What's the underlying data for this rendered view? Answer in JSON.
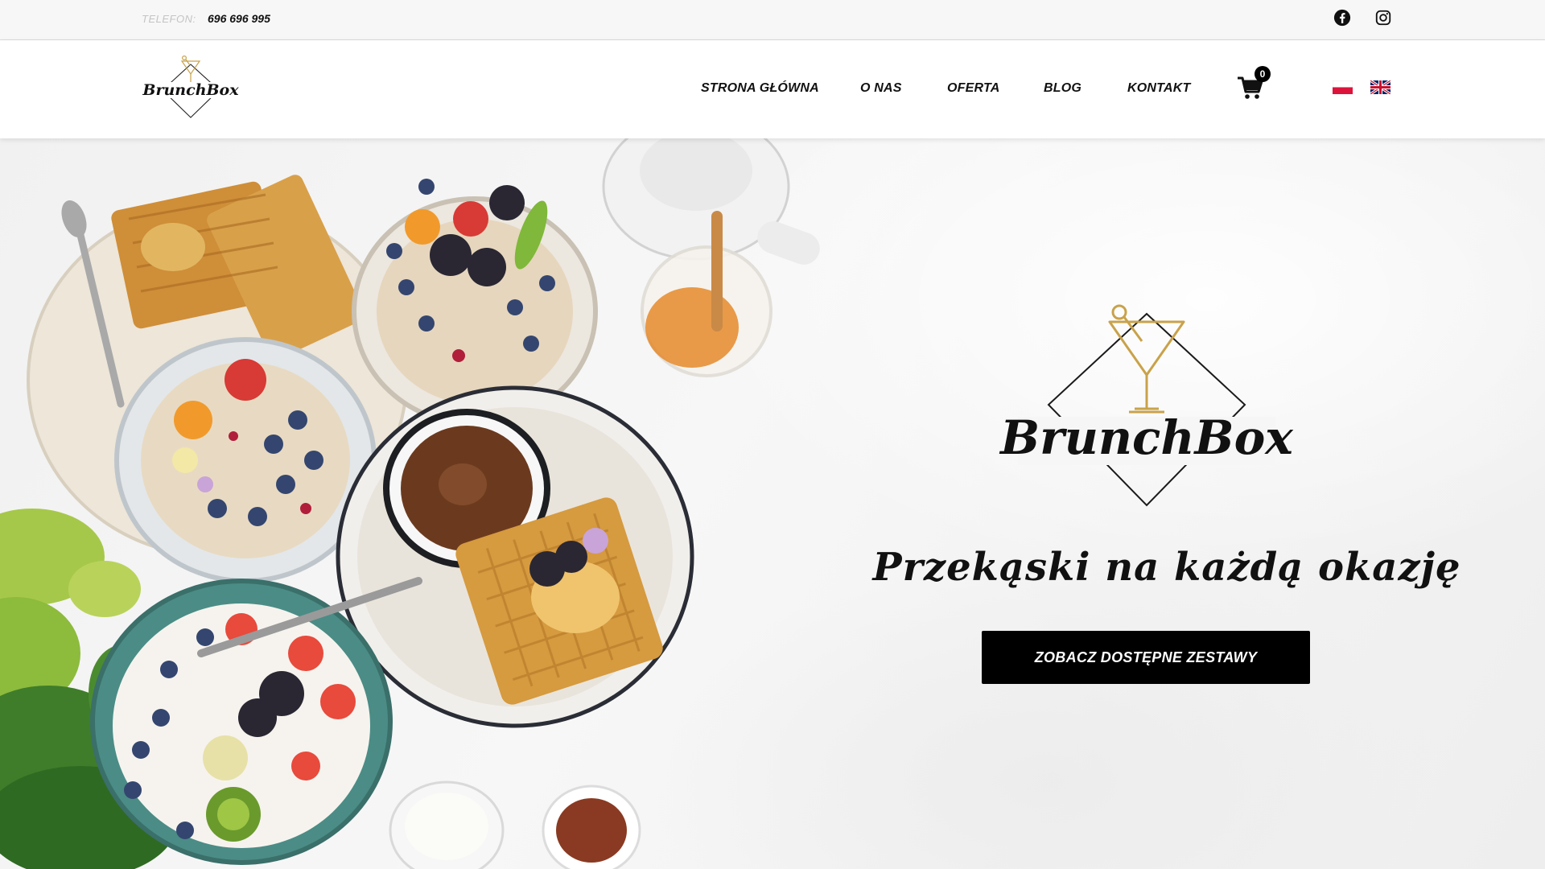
{
  "topbar": {
    "phone_label": "TELEFON:",
    "phone_number": "696 696 995",
    "social": [
      {
        "name": "facebook-icon"
      },
      {
        "name": "instagram-icon"
      }
    ]
  },
  "header": {
    "logo_text": "BrunchBox",
    "nav": [
      {
        "label": "STRONA GŁÓWNA"
      },
      {
        "label": "O NAS"
      },
      {
        "label": "OFERTA"
      },
      {
        "label": "BLOG"
      },
      {
        "label": "KONTAKT"
      }
    ],
    "cart_count": "0",
    "languages": [
      {
        "code": "pl",
        "icon": "poland-flag-icon"
      },
      {
        "code": "en",
        "icon": "uk-flag-icon"
      }
    ]
  },
  "hero": {
    "logo_text": "BrunchBox",
    "tagline": "Przekąski na każdą okazję",
    "cta_label": "ZOBACZ DOSTĘPNE ZESTAWY"
  },
  "colors": {
    "accent": "#000000",
    "gold": "#c9a24a",
    "background": "#f4f4f3"
  }
}
